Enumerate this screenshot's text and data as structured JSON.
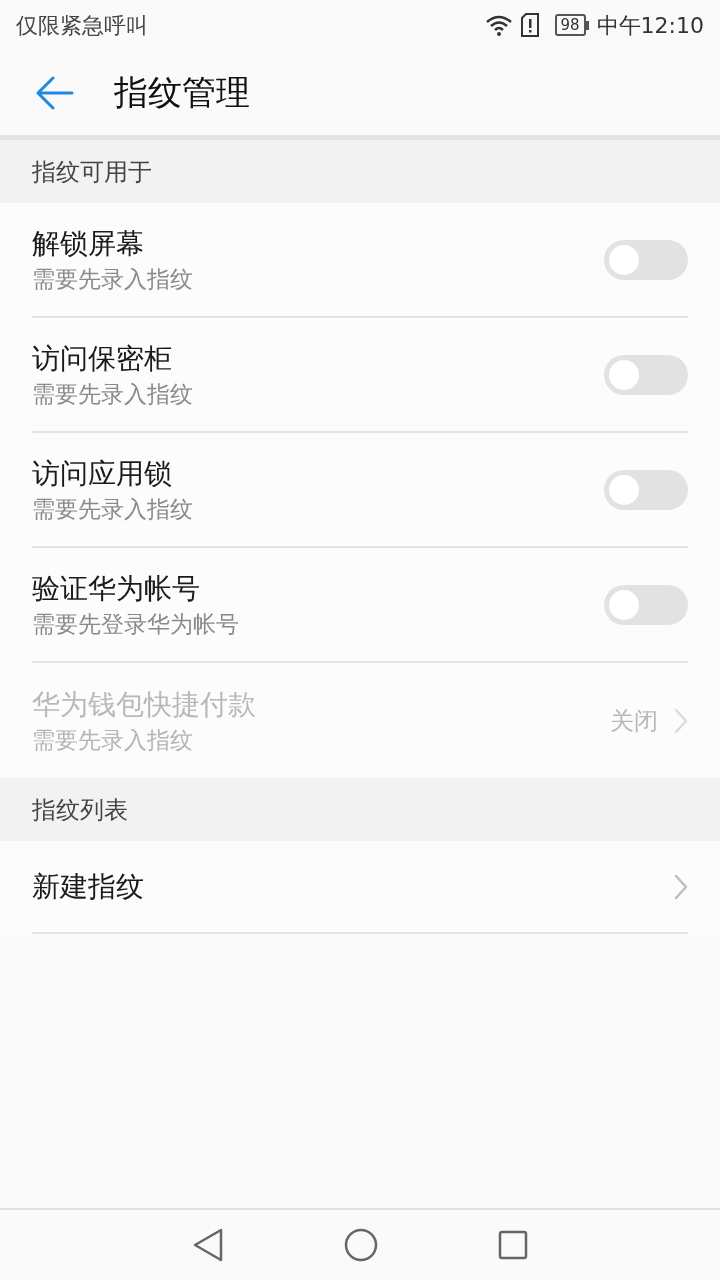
{
  "status_bar": {
    "carrier": "仅限紧急呼叫",
    "battery": "98",
    "time": "中午12:10"
  },
  "header": {
    "title": "指纹管理"
  },
  "sections": [
    {
      "title": "指纹可用于",
      "items": [
        {
          "kind": "toggle",
          "title": "解锁屏幕",
          "subtitle": "需要先录入指纹",
          "on": false,
          "disabled": false
        },
        {
          "kind": "toggle",
          "title": "访问保密柜",
          "subtitle": "需要先录入指纹",
          "on": false,
          "disabled": false
        },
        {
          "kind": "toggle",
          "title": "访问应用锁",
          "subtitle": "需要先录入指纹",
          "on": false,
          "disabled": false
        },
        {
          "kind": "toggle",
          "title": "验证华为帐号",
          "subtitle": "需要先登录华为帐号",
          "on": false,
          "disabled": false
        },
        {
          "kind": "link",
          "title": "华为钱包快捷付款",
          "subtitle": "需要先录入指纹",
          "value": "关闭",
          "disabled": true
        }
      ]
    },
    {
      "title": "指纹列表",
      "items": [
        {
          "kind": "link",
          "title": "新建指纹",
          "disabled": false
        }
      ]
    }
  ]
}
